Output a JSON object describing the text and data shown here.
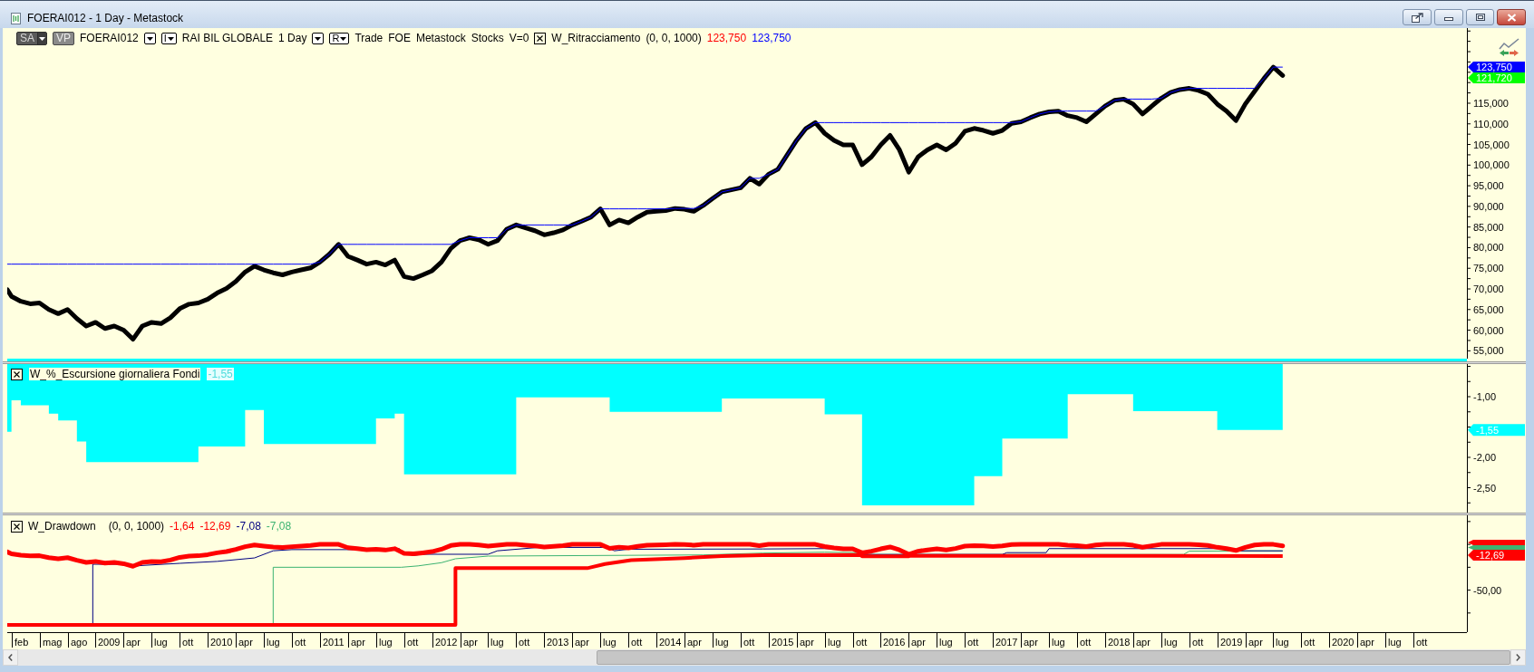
{
  "window": {
    "title": "FOERAI012 - 1 Day - Metastock"
  },
  "price_pane": {
    "legend": [
      {
        "kind": "menu_button",
        "label": "SA"
      },
      {
        "kind": "button",
        "label": "VP"
      },
      {
        "kind": "text",
        "label": "FOERAI012"
      },
      {
        "kind": "dropdown"
      },
      {
        "kind": "dropdown",
        "label": "I"
      },
      {
        "kind": "text",
        "label": "RAI BIL GLOBALE"
      },
      {
        "kind": "text",
        "label": "1 Day"
      },
      {
        "kind": "dropdown"
      },
      {
        "kind": "dropdown",
        "label": "R"
      },
      {
        "kind": "text",
        "label": "Trade"
      },
      {
        "kind": "text",
        "label": "FOE"
      },
      {
        "kind": "text",
        "label": "Metastock"
      },
      {
        "kind": "text",
        "label": "Stocks"
      },
      {
        "kind": "text",
        "label": "V=0"
      },
      {
        "kind": "close"
      },
      {
        "kind": "text",
        "label": "W_Ritracciamento"
      },
      {
        "kind": "text",
        "label": "(0, 0, 1000)"
      },
      {
        "kind": "value",
        "label": "123,750",
        "color": "#ff0000"
      },
      {
        "kind": "value",
        "label": "123,750",
        "color": "#0000ff"
      }
    ],
    "value_tags": [
      {
        "text": "123,750",
        "color": "#0000ff"
      },
      {
        "text": "121,720",
        "color": "#00ff00"
      }
    ],
    "axis_labels": [
      "115,000",
      "110,000",
      "105,000",
      "100,000",
      "95,000",
      "90,000",
      "85,000",
      "80,000",
      "75,000",
      "70,000",
      "65,000",
      "60,000",
      "55,000"
    ]
  },
  "escursione_pane": {
    "legend": {
      "title": "W_%_Escursione giornaliera Fondi",
      "values": [
        {
          "text": "-1,55"
        }
      ]
    },
    "value_tags": [
      {
        "text": "-1,55",
        "color": "#00ffff"
      }
    ],
    "axis_labels": [
      "-1,00",
      "-2,00",
      "-2,50"
    ]
  },
  "drawdown_pane": {
    "legend": {
      "title": "W_Drawdown",
      "params": "(0, 0, 1000)",
      "values": [
        {
          "text": "-1,64",
          "color": "#ff0000"
        },
        {
          "text": "-12,69",
          "color": "#ff0000"
        },
        {
          "text": "-7,08",
          "color": "#000080"
        },
        {
          "text": "-7,08",
          "color": "#3cb371"
        }
      ]
    },
    "value_tags": [
      {
        "color": "#ff0000"
      },
      {
        "color": "#3cb371"
      },
      {
        "text": "-12,69",
        "color": "#ff0000"
      }
    ],
    "axis_labels": [
      "-50,00"
    ]
  },
  "date_axis": {
    "labels": [
      "feb",
      "mag",
      "ago",
      "2009",
      "apr",
      "lug",
      "ott",
      "2010",
      "apr",
      "lug",
      "ott",
      "2011",
      "apr",
      "lug",
      "ott",
      "2012",
      "apr",
      "lug",
      "ott",
      "2013",
      "apr",
      "lug",
      "ott",
      "2014",
      "apr",
      "lug",
      "ott",
      "2015",
      "apr",
      "lug",
      "ott",
      "2016",
      "apr",
      "lug",
      "ott",
      "2017",
      "apr",
      "lug",
      "ott",
      "2018",
      "apr",
      "lug",
      "ott",
      "2019",
      "apr",
      "lug",
      "ott",
      "2020",
      "apr",
      "lug",
      "ott"
    ]
  }
}
